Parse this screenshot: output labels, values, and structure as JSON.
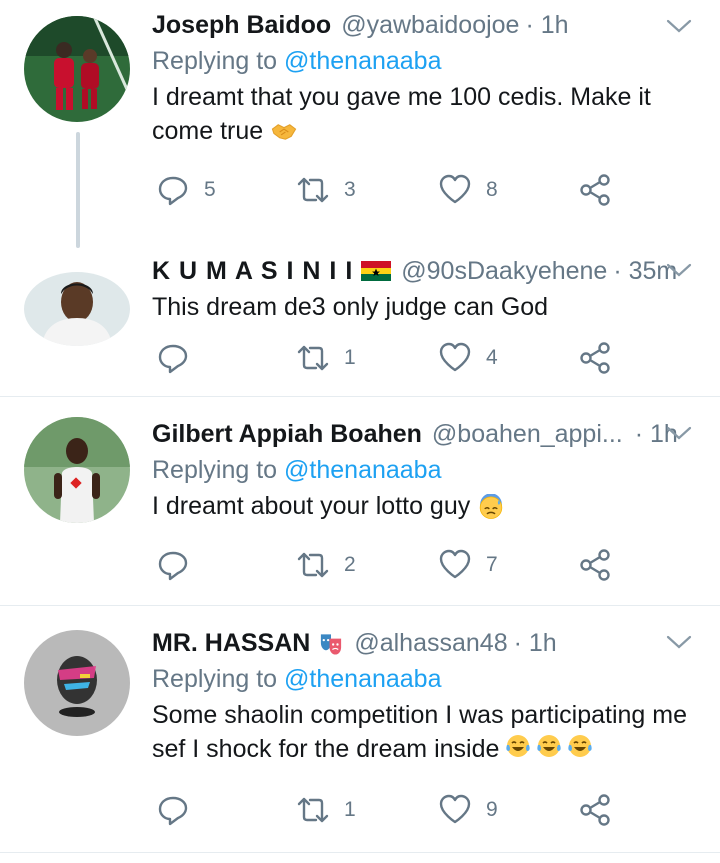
{
  "tweets": [
    {
      "name": "Joseph Baidoo",
      "handle": "@yawbaidoojoe",
      "time": "· 1h",
      "replying_label": "Replying to",
      "replying_to": "@thenanaaba",
      "text_line1": "I dreamt that you gave me 100 cedis. Make it",
      "text_line2": "come true",
      "emoji": "handshake-emoji",
      "replies": "5",
      "retweets": "3",
      "likes": "8"
    },
    {
      "name": "K U M A S I N I I",
      "handle": "@90sDaakyehene",
      "time": "· 35m",
      "text_line1": "This dream de3 only judge can God",
      "replies": "",
      "retweets": "1",
      "likes": "4"
    },
    {
      "name": "Gilbert Appiah Boahen",
      "handle": "@boahen_appi...",
      "time": "· 1h",
      "replying_label": "Replying to",
      "replying_to": "@thenanaaba",
      "text_line1": "I dreamt about your lotto guy",
      "emoji": "sweat-face-emoji",
      "replies": "",
      "retweets": "2",
      "likes": "7"
    },
    {
      "name": "MR. HASSAN",
      "handle": "@alhassan48",
      "time": "· 1h",
      "replying_label": "Replying to",
      "replying_to": "@thenanaaba",
      "text_line1": "Some shaolin competition I was participating me",
      "text_line2": "sef I shock for the dream inside",
      "emoji": "laughing-tears-emoji",
      "replies": "",
      "retweets": "1",
      "likes": "9"
    }
  ],
  "colors": {
    "accent": "#1da1f2",
    "secondary_text": "#657786",
    "primary_text": "#14171a",
    "divider": "#e6ecf0",
    "thread_line": "#ccd6dd"
  }
}
